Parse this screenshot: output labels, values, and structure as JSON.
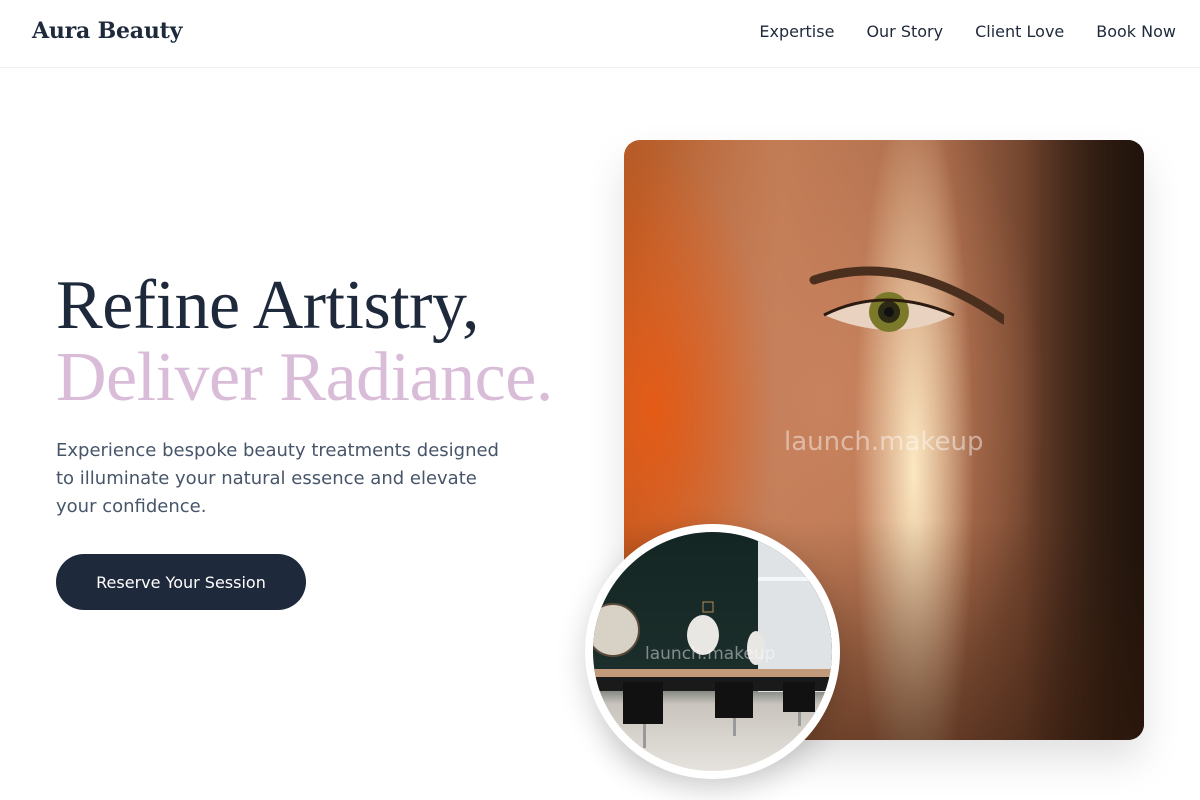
{
  "header": {
    "brand": "Aura Beauty",
    "nav": [
      "Expertise",
      "Our Story",
      "Client Love",
      "Book Now"
    ]
  },
  "hero": {
    "title_line1": "Refine Artistry,",
    "title_line2": "Deliver Radiance.",
    "description": "Experience bespoke beauty treatments designed to illuminate your natural essence and elevate your confidence.",
    "cta": "Reserve Your Session"
  },
  "images": {
    "main_watermark": "launch.makeup",
    "circle_watermark": "launch.makeup"
  },
  "colors": {
    "primary": "#1e293b",
    "accent": "#d9bcd8",
    "text_muted": "#475569"
  }
}
